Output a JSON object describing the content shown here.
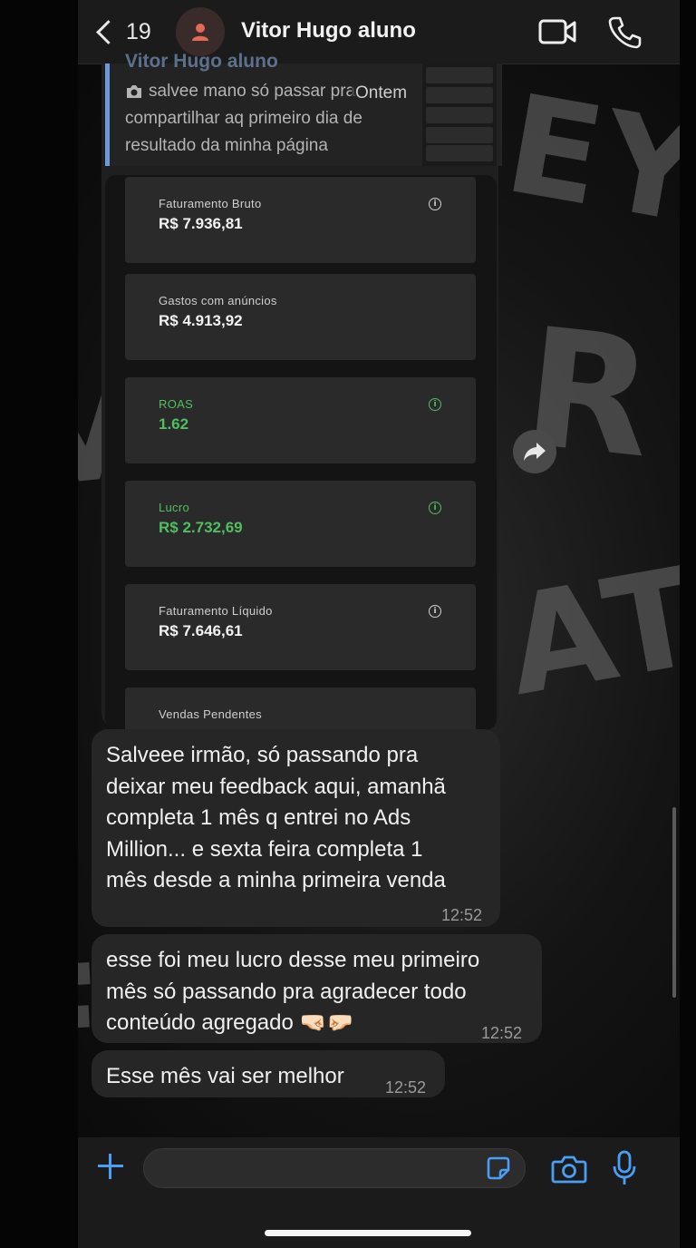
{
  "header": {
    "back_count": "19",
    "contact_name": "Vitor Hugo aluno"
  },
  "quoted": {
    "author": "Vitor Hugo aluno",
    "text": "salvee mano só passar pra compartilhar aq primeiro dia de resultado da minha página",
    "date_overlay": "Ontem"
  },
  "dashboard": {
    "cards": [
      {
        "label": "Faturamento Bruto",
        "value": "R$ 7.936,81",
        "highlight": false
      },
      {
        "label": "Gastos com anúncios",
        "value": "R$ 4.913,92",
        "highlight": false
      },
      {
        "label": "ROAS",
        "value": "1.62",
        "highlight": true
      },
      {
        "label": "Lucro",
        "value": "R$ 2.732,69",
        "highlight": true
      },
      {
        "label": "Faturamento Líquido",
        "value": "R$ 7.646,61",
        "highlight": false
      },
      {
        "label": "Vendas Pendentes",
        "value": "",
        "highlight": false
      }
    ],
    "info_glyph": "i"
  },
  "messages": [
    {
      "lines": [
        "Salveee irmão, só passando pra",
        "deixar meu feedback aqui, amanhã",
        "completa 1 mês q entrei no Ads",
        "Million... e sexta feira completa 1",
        "mês desde a minha primeira venda"
      ],
      "time": "12:52"
    },
    {
      "lines": [
        "esse foi meu lucro desse meu primeiro",
        "mês só passando pra agradecer todo",
        "conteúdo agregado 🤜🏻🤛🏻"
      ],
      "time": "12:52"
    },
    {
      "lines": [
        "Esse mês vai ser melhor"
      ],
      "time": "12:52"
    }
  ],
  "composer": {
    "placeholder": ""
  },
  "colors": {
    "accent": "#4a9ff5",
    "bubble": "#262626",
    "positive": "#4fbf60",
    "quote_bar": "#6a9bd8"
  },
  "icons": [
    "chevron-left-icon",
    "person-icon",
    "video-camera-icon",
    "phone-icon",
    "camera-icon",
    "info-icon",
    "forward-arrow-icon",
    "plus-icon",
    "sticker-icon",
    "microphone-icon"
  ]
}
